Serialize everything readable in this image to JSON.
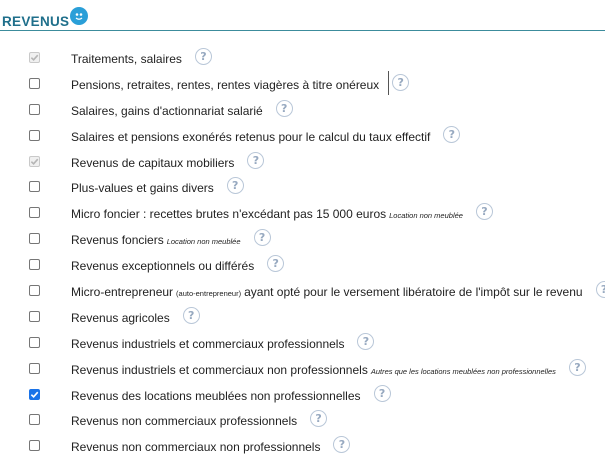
{
  "header": {
    "title": "REVENUS"
  },
  "help_glyph": "?",
  "items": [
    {
      "label": "Traitements, salaires",
      "note": "",
      "state": "disabled-checked"
    },
    {
      "label": "Pensions, retraites, rentes, rentes viagères à titre onéreux",
      "note": "",
      "state": "unchecked"
    },
    {
      "label": "Salaires, gains d'actionnariat salarié",
      "note": "",
      "state": "unchecked"
    },
    {
      "label": "Salaires et pensions exonérés retenus pour le calcul du taux effectif",
      "note": "",
      "state": "unchecked"
    },
    {
      "label": "Revenus de capitaux mobiliers",
      "note": "",
      "state": "disabled-checked"
    },
    {
      "label": "Plus-values et gains divers",
      "note": "",
      "state": "unchecked"
    },
    {
      "label": "Micro foncier : recettes brutes n'excédant pas 15 000 euros",
      "note": "Location non meublée",
      "state": "unchecked"
    },
    {
      "label": "Revenus fonciers",
      "note": "Location non meublée",
      "state": "unchecked"
    },
    {
      "label": "Revenus exceptionnels ou différés",
      "note": "",
      "state": "unchecked"
    },
    {
      "label": "Micro-entrepreneur",
      "small_note": "(auto-entrepreneur)",
      "label_after": "ayant opté pour le versement libératoire de l'impôt sur le revenu",
      "note": "",
      "state": "unchecked"
    },
    {
      "label": "Revenus agricoles",
      "note": "",
      "state": "unchecked"
    },
    {
      "label": "Revenus industriels et commerciaux professionnels",
      "note": "",
      "state": "unchecked"
    },
    {
      "label": "Revenus industriels et commerciaux non professionnels",
      "note": "Autres que les locations meublées non professionnelles",
      "state": "unchecked"
    },
    {
      "label": "Revenus des locations meublées non professionnelles",
      "note": "",
      "state": "checked"
    },
    {
      "label": "Revenus non commerciaux professionnels",
      "note": "",
      "state": "unchecked"
    },
    {
      "label": "Revenus non commerciaux non professionnels",
      "note": "",
      "state": "unchecked"
    }
  ]
}
